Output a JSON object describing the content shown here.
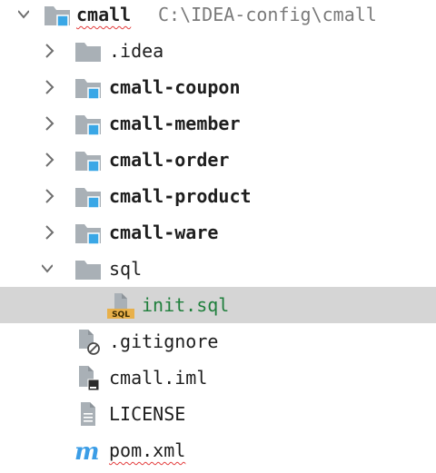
{
  "project": {
    "name": "cmall",
    "path": "C:\\IDEA-config\\cmall"
  },
  "tree": [
    {
      "label": ".idea",
      "icon": "folder-icon"
    },
    {
      "label": "cmall-coupon",
      "icon": "module-folder-icon"
    },
    {
      "label": "cmall-member",
      "icon": "module-folder-icon"
    },
    {
      "label": "cmall-order",
      "icon": "module-folder-icon"
    },
    {
      "label": "cmall-product",
      "icon": "module-folder-icon"
    },
    {
      "label": "cmall-ware",
      "icon": "module-folder-icon"
    },
    {
      "label": "sql",
      "icon": "folder-icon"
    },
    {
      "label": "init.sql",
      "icon": "sql-file-icon",
      "sql_badge": "SQL"
    },
    {
      "label": ".gitignore",
      "icon": "ignored-file-icon"
    },
    {
      "label": "cmall.iml",
      "icon": "iml-file-icon"
    },
    {
      "label": "LICENSE",
      "icon": "text-file-icon"
    },
    {
      "label": "pom.xml",
      "icon": "maven-icon",
      "maven_glyph": "m"
    }
  ],
  "colors": {
    "selection": "#d5d5d5",
    "folder": "#a9b0b6",
    "module_badge": "#3aa7e6",
    "modified_green": "#1f7f3c",
    "maven_blue": "#3b9de6",
    "error_squiggle": "#e33d3d"
  }
}
